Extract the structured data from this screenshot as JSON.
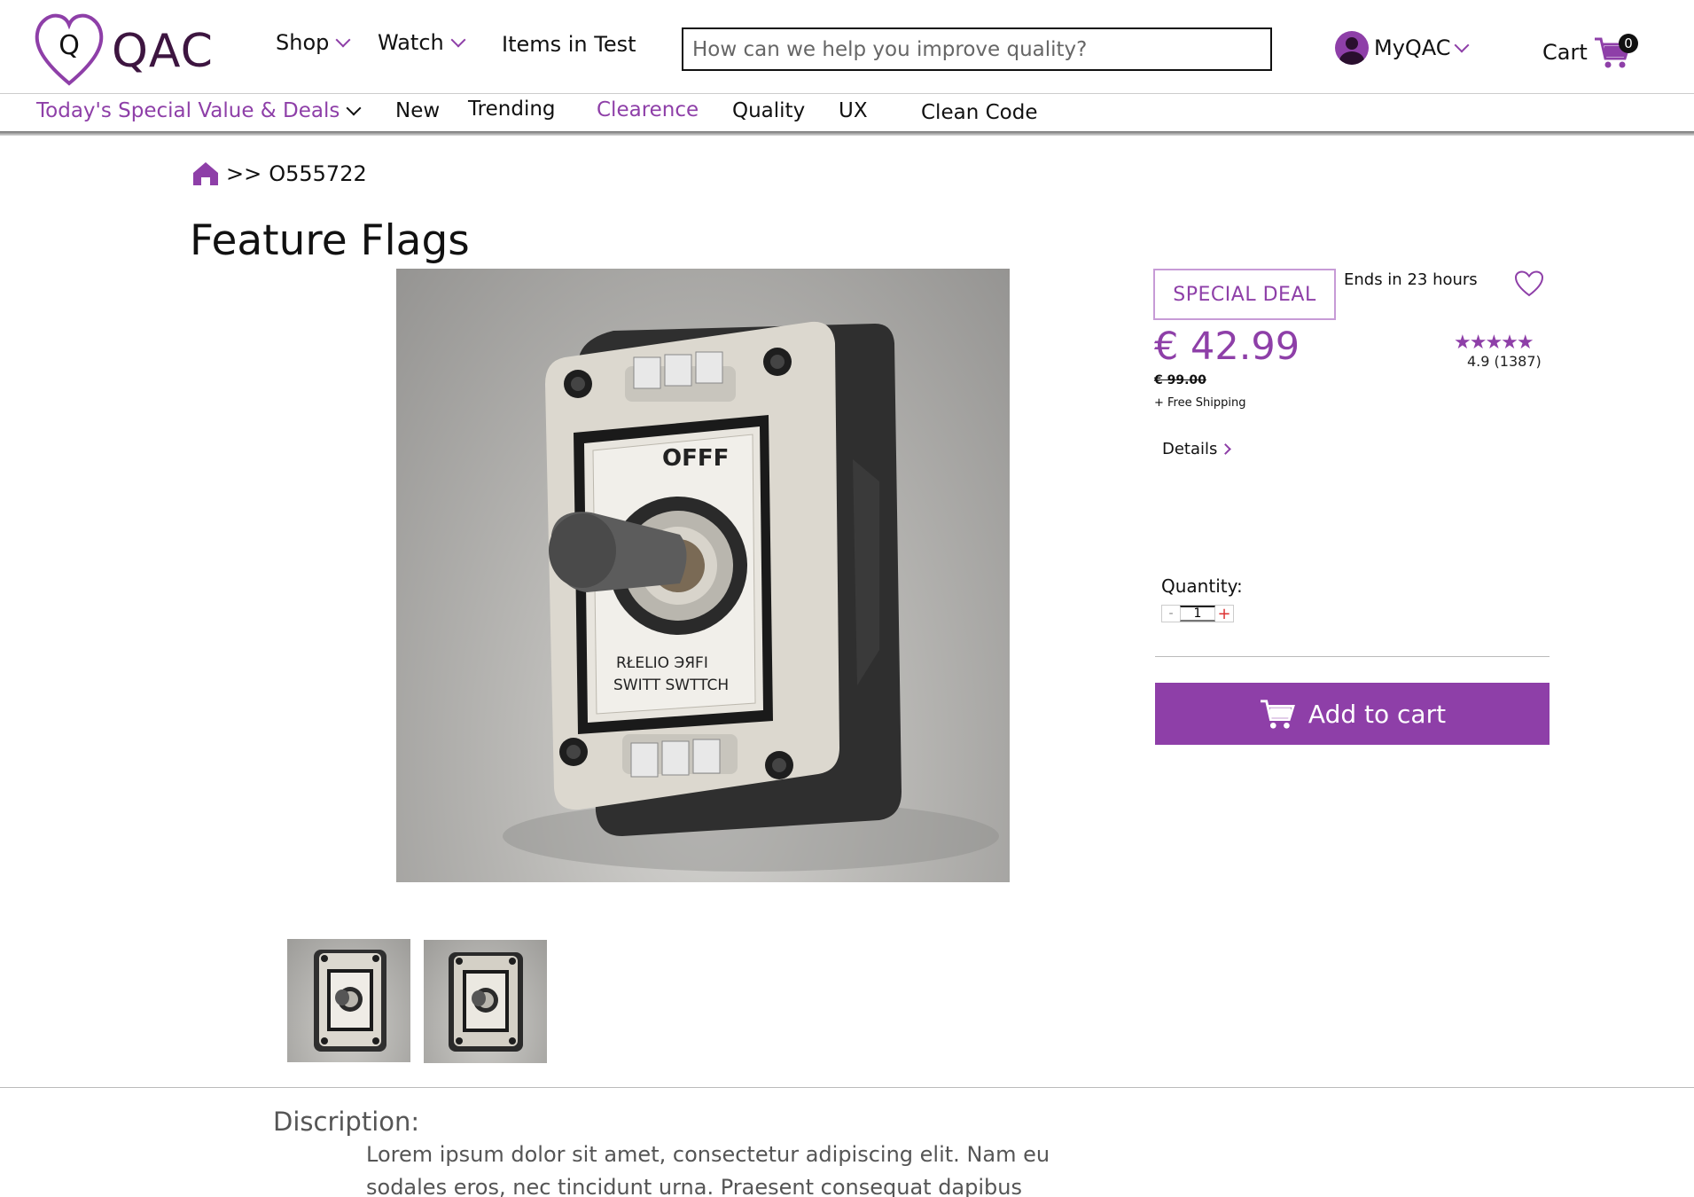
{
  "brand": {
    "logo_letter": "Q",
    "name": "QAC"
  },
  "nav": {
    "shop": "Shop",
    "watch": "Watch",
    "items_in_test": "Items in Test",
    "search_placeholder": "How can we help you improve quality?",
    "account": "MyQAC",
    "cart": "Cart",
    "cart_count": "0"
  },
  "subnav": {
    "deals": "Today's Special Value & Deals",
    "new": "New",
    "trending": "Trending",
    "clearence": "Clearence",
    "quality": "Quality",
    "ux": "UX",
    "clean_code": "Clean Code"
  },
  "breadcrumb": {
    "separator": ">>",
    "item_code": "O555722"
  },
  "product": {
    "title": "Feature Flags",
    "badge": "SPECIAL DEAL",
    "ends_in": "Ends in 23 hours",
    "price": "€ 42.99",
    "old_price": "€ 99.00",
    "shipping": "+ Free Shipping",
    "stars": "★★★★★",
    "rating": "4.9 (1387)",
    "details_link": "Details",
    "quantity_label": "Quantity:",
    "quantity_minus": "-",
    "quantity_value": "1",
    "quantity_plus": "+",
    "add_to_cart": "Add to cart",
    "switch_label_top": "OFFF",
    "switch_label_bottom_1": "RŁELIO ЭЯFI",
    "switch_label_bottom_2": "SWITT SWTTCH"
  },
  "description": {
    "heading": "Discription:",
    "body": "Lorem ipsum dolor sit amet, consectetur adipiscing elit. Nam eu sodales eros, nec tincidunt urna. Praesent consequat dapibus"
  },
  "colors": {
    "accent": "#8e3fa8",
    "logo_dark": "#3d1540"
  },
  "icons": {
    "heart": "heart-icon",
    "home": "home-icon",
    "cart": "cart-icon",
    "user": "user-avatar-icon"
  }
}
